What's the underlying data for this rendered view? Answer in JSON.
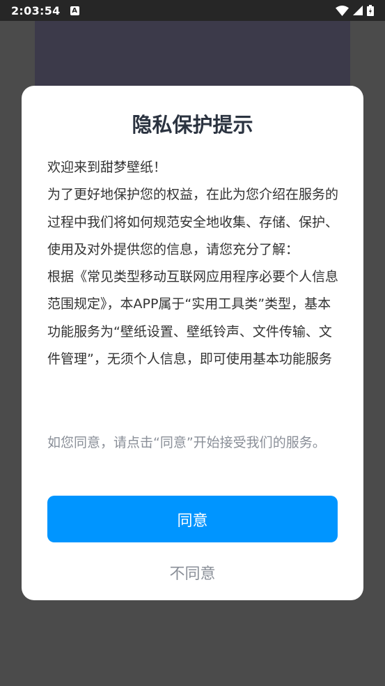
{
  "status_bar": {
    "time": "2:03:54",
    "notification_icon": "a-badge-icon",
    "icons": [
      "wifi-icon",
      "signal-icon",
      "battery-icon"
    ]
  },
  "dialog": {
    "title": "隐私保护提示",
    "body_paragraphs": [
      "欢迎来到甜梦壁纸！",
      "为了更好地保护您的权益，在此为您介绍在服务的过程中我们将如何规范安全地收集、存储、保护、使用及对外提供您的信息，请您充分了解：",
      "根据《常见类型移动互联网应用程序必要个人信息范围规定》，本APP属于“实用工具类”类型，基本功能服务为“壁纸设置、壁纸铃声、文件传输、文件管理”，无须个人信息，即可使用基本功能服务"
    ],
    "note": "如您同意，请点击“同意”开始接受我们的服务。",
    "agree_label": "同意",
    "disagree_label": "不同意"
  },
  "colors": {
    "primary": "#0095ff",
    "overlay": "#4b4b4b",
    "status_bar": "#262626",
    "muted_text": "#8a8f98"
  }
}
